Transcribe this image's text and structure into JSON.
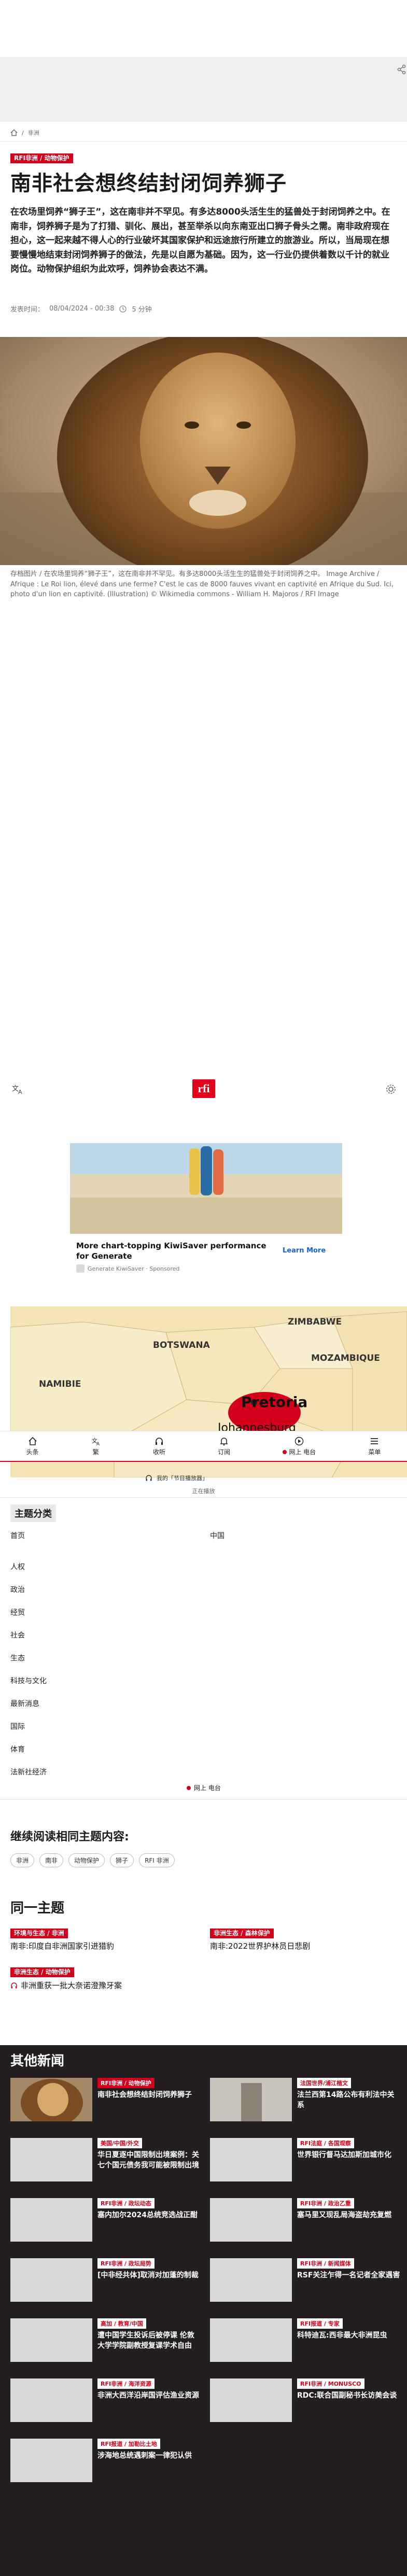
{
  "breadcrumb": {
    "items": [
      "非洲"
    ]
  },
  "article": {
    "badge": "RFI非洲 / 动物保护",
    "title": "南非社会想终结封闭饲养狮子",
    "lead": "在农场里饲养“狮子王”，这在南非并不罕见。有多达8000头活生生的猛兽处于封闭饲养之中。在南非，饲养狮子是为了打猎、驯化、展出，甚至举杀以向东南亚出口狮子骨头之需。南非政府现在担心，这一起来越不得人心的行业破坏其国家保护和远途旅行所建立的旅游业。所以，当局现在想要慢慢地结束封闭饲养狮子的做法，先是以自愿为基础。因为，这一行业仍提供着数以千计的就业岗位。动物保护组织为此欢呼，饲养协会表达不满。",
    "meta_label": "发表时间：",
    "date": "08/04/2024 - 00:38",
    "read_time": "5 分钟",
    "caption": "存档图片 / 在农场里饲养“狮子王”，这在南非并不罕见。有多达8000头活生生的猛兽处于封闭饲养之中。 Image Archive / Afrique : Le Roi lion, élevé dans une ferme? C'est le cas de 8000 fauves vivant en captivité en Afrique du Sud. Ici, photo d'un lion en captivité. (Illustration) © Wikimedia commons - William H. Majoros / RFI Image"
  },
  "brand": {
    "logo": "rfi",
    "accent": "#d2001a",
    "dark_bg": "#231f20"
  },
  "sponsor": {
    "title": "More chart-topping KiwiSaver performance for Generate",
    "cta": "Learn More",
    "source": "Generate KiwiSaver · Sponsored"
  },
  "map": {
    "labels": [
      "ZIMBABWE",
      "BOTSWANA",
      "MOZAMBIQUE",
      "NAMIBIE",
      "Pretoria",
      "Johannesburg"
    ]
  },
  "tabbar": {
    "items": [
      {
        "label": "头条",
        "icon": "home-icon"
      },
      {
        "label": "繁",
        "icon": "translate-icon"
      },
      {
        "label": "收听",
        "icon": "headphones-icon"
      },
      {
        "label": "订阅",
        "icon": "bell-icon"
      },
      {
        "label": "网上 电台",
        "icon": "play-icon"
      },
      {
        "label": "菜单",
        "icon": "menu-icon"
      }
    ]
  },
  "radio": {
    "label": "我的「节目播放器」",
    "now": "正在播放"
  },
  "topics": {
    "heading": "主题分类",
    "left": [
      "首页",
      "人权",
      "政治",
      "经贸",
      "社会",
      "生态",
      "科技与文化",
      "最新消息",
      "国际",
      "体育",
      "法新社经济"
    ],
    "right": [
      "中国"
    ],
    "listen": "网上 电台"
  },
  "continue": {
    "heading": "继续阅读相同主题内容:",
    "chips": [
      "非洲",
      "南非",
      "动物保护",
      "狮子",
      "RFI 非洲"
    ]
  },
  "same_topic": {
    "heading": "同一主题",
    "articles": [
      {
        "badge": "环境与生态 / 非洲",
        "title": "南非:印度自非洲国家引进猎豹"
      },
      {
        "badge": "非洲生态 / 森林保护",
        "title": "南非:2022世界护林员日悲剧"
      },
      {
        "badge": "非洲生态 / 动物保护",
        "title": "非洲重获一批大奈诺澄豫牙案"
      }
    ]
  },
  "other_news": {
    "heading": "其他新闻",
    "cards": [
      {
        "badge": "RFI非洲 / 动物保护",
        "title": "南非社会想终结封闭饲养狮子",
        "red": true
      },
      {
        "badge": "法国世界/浦江楷文",
        "title": "法兰西第14路公布有利法中关系",
        "red": false
      },
      {
        "badge": "美国/中国/外交",
        "title": "华日夏逐中国限制出境案例：关七个国元债务我可能被限制出境",
        "red": false
      },
      {
        "badge": "RFI法庭 / 各国观察",
        "title": "世界银行督马达加斯加城市化",
        "red": false
      },
      {
        "badge": "RFI非洲 / 政坛动态",
        "title": "塞内加尔2024总统竞选战正酣",
        "red": false
      },
      {
        "badge": "RFI非洲 / 政治乙重",
        "title": "塞马里又现乱局海盗劫充复燃",
        "red": false
      },
      {
        "badge": "RFI非洲 / 政坛局势",
        "title": "[中非经共体]取消对加蓬的制裁",
        "red": false
      },
      {
        "badge": "RFI非洲 / 新闻媒体",
        "title": "RSF关注乍得一名记者全家遇害",
        "red": false
      },
      {
        "badge": "高加 / 教育/中国",
        "title": "遭中国学生投诉后被停课 伦敦大学学院副教授复课学术自由",
        "red": false
      },
      {
        "badge": "RFI报道 / 专家",
        "title": "科特迪瓦:西非最大非洲昆虫",
        "red": false
      },
      {
        "badge": "RFI非洲 / 海洋资源",
        "title": "非洲大西洋沿岸国评估渔业资源",
        "red": false
      },
      {
        "badge": "RFI非洲 / MONUSCO",
        "title": "RDC:联合国副秘书长访美会谈",
        "red": false
      },
      {
        "badge": "RFI报道 / 加勒比土地",
        "title": "涉海地总统遇刺案一律犯认供",
        "red": false
      }
    ]
  }
}
